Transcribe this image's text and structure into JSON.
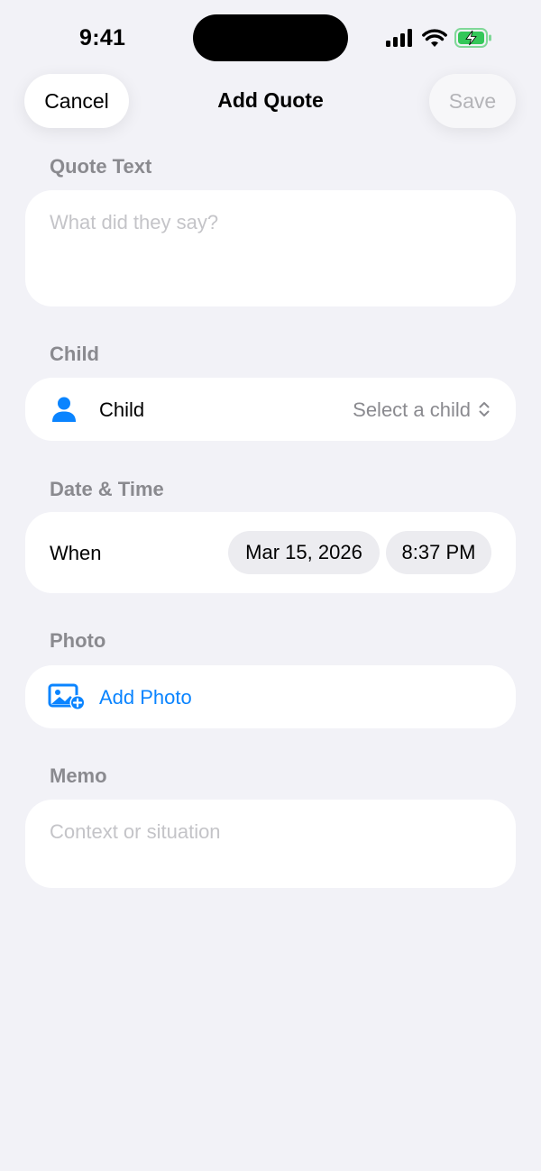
{
  "status_bar": {
    "time": "9:41"
  },
  "nav": {
    "cancel_label": "Cancel",
    "title": "Add Quote",
    "save_label": "Save"
  },
  "quote_section": {
    "label": "Quote Text",
    "placeholder": "What did they say?"
  },
  "child_section": {
    "label": "Child",
    "row_label": "Child",
    "value": "Select a child",
    "icon": "person-icon"
  },
  "datetime_section": {
    "label": "Date & Time",
    "row_label": "When",
    "date": "Mar 15, 2026",
    "time": "8:37 PM"
  },
  "photo_section": {
    "label": "Photo",
    "button_label": "Add Photo",
    "icon": "add-photo-icon"
  },
  "memo_section": {
    "label": "Memo",
    "placeholder": "Context or situation"
  },
  "colors": {
    "accent": "#0a84ff",
    "background": "#f2f2f7",
    "secondary_text": "#8a8a8f",
    "battery": "#34c759"
  }
}
